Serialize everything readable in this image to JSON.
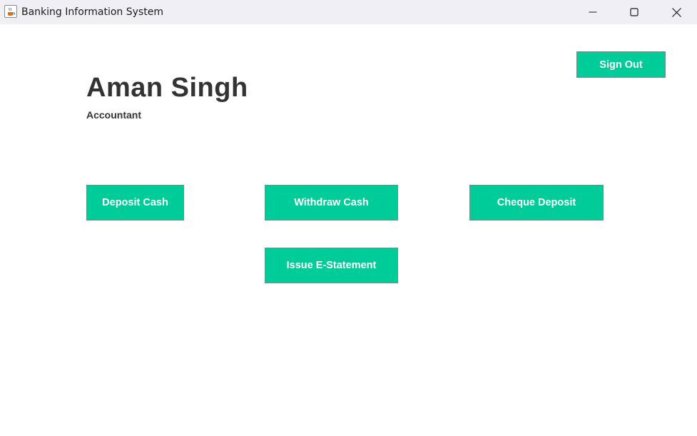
{
  "window": {
    "title": "Banking Information System",
    "icon": "java-cup-icon",
    "controls": [
      "minimize-icon",
      "maximize-icon",
      "close-icon"
    ]
  },
  "user": {
    "name": "Aman Singh",
    "role": "Accountant"
  },
  "actions": {
    "sign_out": "Sign Out",
    "deposit_cash": "Deposit Cash",
    "withdraw_cash": "Withdraw Cash",
    "cheque_deposit": "Cheque Deposit",
    "issue_statement": "Issue E-Statement"
  },
  "colors": {
    "button_bg": "#00cc99",
    "button_text": "#ffffff",
    "heading_text": "#333333",
    "titlebar_bg": "#f1eff6"
  }
}
